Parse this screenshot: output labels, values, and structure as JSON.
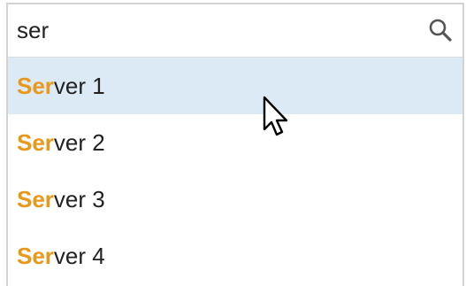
{
  "search": {
    "value": "ser",
    "icon": "search-icon"
  },
  "results": [
    {
      "match": "Ser",
      "rest": "ver 1",
      "highlighted": true
    },
    {
      "match": "Ser",
      "rest": "ver 2",
      "highlighted": false
    },
    {
      "match": "Ser",
      "rest": "ver 3",
      "highlighted": false
    },
    {
      "match": "Ser",
      "rest": "ver 4",
      "highlighted": false
    }
  ],
  "colors": {
    "match_highlight": "#e8981a",
    "row_hover": "#dceaf6"
  },
  "cursor": {
    "icon": "mouse-pointer-icon"
  }
}
